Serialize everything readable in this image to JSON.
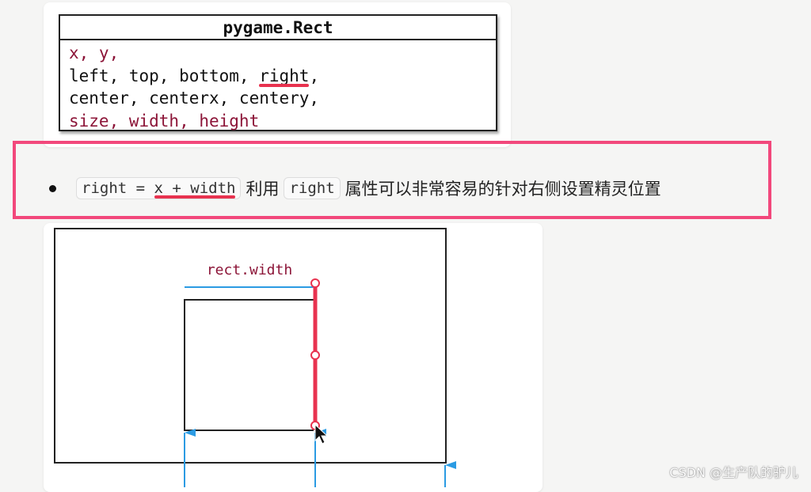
{
  "rect_class": {
    "title": "pygame.Rect",
    "lines": [
      {
        "text": "x, y,",
        "color": "#8c1538"
      },
      {
        "parts": [
          "left, top, bottom, ",
          "right",
          ","
        ]
      },
      {
        "text": "center, centerx, centery,"
      },
      {
        "text": "size, width, height",
        "color": "#8c1538"
      }
    ]
  },
  "note": {
    "code1_pre": "right = ",
    "code1_underlined": "x + width",
    "text1": "利用",
    "code2": "right",
    "text2": "属性可以非常容易的针对右侧设置精灵位置"
  },
  "diagram": {
    "label": "rect.width",
    "colors": {
      "highlight": "#e8324f",
      "arrow": "#2b9be3",
      "label": "#8c1538",
      "frame": "#f2487c"
    }
  },
  "watermark": "CSDN @生产队的驴儿"
}
